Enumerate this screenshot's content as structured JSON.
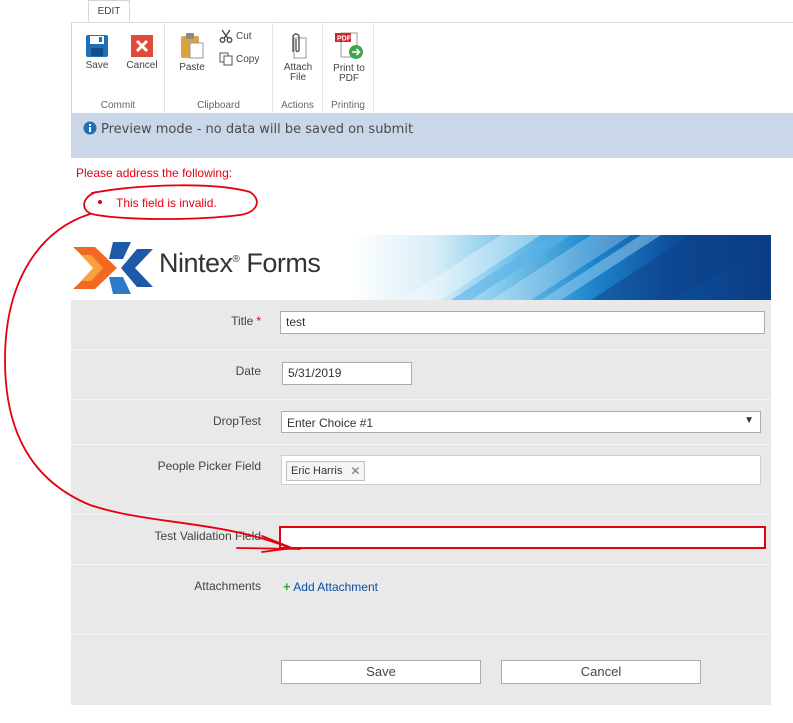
{
  "ribbon": {
    "tab_label": "EDIT",
    "groups": {
      "commit": {
        "label": "Commit",
        "save_label": "Save",
        "cancel_label": "Cancel"
      },
      "clipboard": {
        "label": "Clipboard",
        "paste_label": "Paste",
        "cut_label": "Cut",
        "copy_label": "Copy"
      },
      "actions": {
        "label": "Actions",
        "attach_label": "Attach\nFile"
      },
      "printing": {
        "label": "Printing",
        "print_label": "Print to\nPDF",
        "pdf_badge": "PDF"
      }
    }
  },
  "status": {
    "text": "Preview mode - no data will be saved on submit"
  },
  "validation": {
    "heading": "Please address the following:",
    "items": [
      "This field is invalid."
    ]
  },
  "banner": {
    "brand": "Nintex",
    "reg": "®",
    "product": "Forms"
  },
  "form": {
    "title": {
      "label": "Title",
      "required_mark": "*",
      "value": "test"
    },
    "date": {
      "label": "Date",
      "value": "5/31/2019"
    },
    "droptest": {
      "label": "DropTest",
      "value": "Enter Choice #1"
    },
    "people": {
      "label": "People Picker Field",
      "person": "Eric Harris",
      "remove": "✕"
    },
    "testval": {
      "label": "Test Validation Field",
      "value": ""
    },
    "attachments": {
      "label": "Attachments",
      "link": "Add Attachment"
    },
    "save_button": "Save",
    "cancel_button": "Cancel"
  },
  "colors": {
    "error_red": "#e4000f",
    "status_bar": "#c9d7e8",
    "form_bg": "#e9e9e9",
    "link_blue": "#0a4ea0"
  }
}
